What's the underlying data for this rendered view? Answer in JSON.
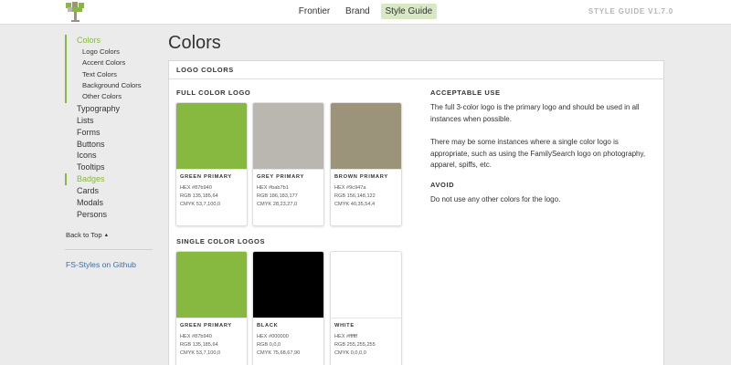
{
  "header": {
    "nav": [
      "Frontier",
      "Brand",
      "Style Guide"
    ],
    "active_nav": "Style Guide",
    "version": "STYLE GUIDE V1.7.0"
  },
  "sidebar": {
    "active_group": {
      "label": "Colors",
      "subitems": [
        "Logo Colors",
        "Accent Colors",
        "Text Colors",
        "Background Colors",
        "Other Colors"
      ]
    },
    "items": [
      "Typography",
      "Lists",
      "Forms",
      "Buttons",
      "Icons",
      "Tooltips",
      "Badges",
      "Cards",
      "Modals",
      "Persons"
    ],
    "marked_item": "Badges",
    "back_to_top": "Back to Top",
    "github_link": "FS-Styles on Github"
  },
  "main": {
    "title": "Colors",
    "panel_title": "LOGO COLORS",
    "full_color": {
      "label": "FULL COLOR LOGO",
      "cards": [
        {
          "name": "GREEN PRIMARY",
          "hex": "HEX #87b940",
          "rgb": "RGB 135,185,64",
          "cmyk": "CMYK 53,7,100,0",
          "color": "#87b940"
        },
        {
          "name": "GREY PRIMARY",
          "hex": "HEX #bab7b1",
          "rgb": "RGB 186,183,177",
          "cmyk": "CMYK 28,23,27,0",
          "color": "#bab7b1"
        },
        {
          "name": "BROWN PRIMARY",
          "hex": "HEX #9c947a",
          "rgb": "RGB 156,148,122",
          "cmyk": "CMYK 40,35,54,4",
          "color": "#9c947a"
        }
      ]
    },
    "single_color": {
      "label": "SINGLE COLOR LOGOS",
      "cards": [
        {
          "name": "GREEN PRIMARY",
          "hex": "HEX #87b940",
          "rgb": "RGB 135,185,64",
          "cmyk": "CMYK 53,7,100,0",
          "color": "#87b940"
        },
        {
          "name": "BLACK",
          "hex": "HEX #000000",
          "rgb": "RGB 0,0,0",
          "cmyk": "CMYK 75,68,67,90",
          "color": "#000000"
        },
        {
          "name": "WHITE",
          "hex": "HEX #ffffff",
          "rgb": "RGB 255,255,255",
          "cmyk": "CMYK 0,0,0,0",
          "color": "#ffffff"
        }
      ]
    },
    "acceptable_use": {
      "heading": "ACCEPTABLE USE",
      "paragraphs": [
        "The full 3-color logo is the primary logo and should be used in all instances when possible.",
        "There may be some instances where a single color logo is appropriate, such as using the FamilySearch logo on photography, apparel, spiffs, etc."
      ]
    },
    "avoid": {
      "heading": "AVOID",
      "text": "Do not use any other colors for the logo."
    }
  },
  "colors": {
    "accent_green": "#87b940",
    "link_blue": "#3b6ea8",
    "nav_active_bg": "#d9e8c4"
  }
}
